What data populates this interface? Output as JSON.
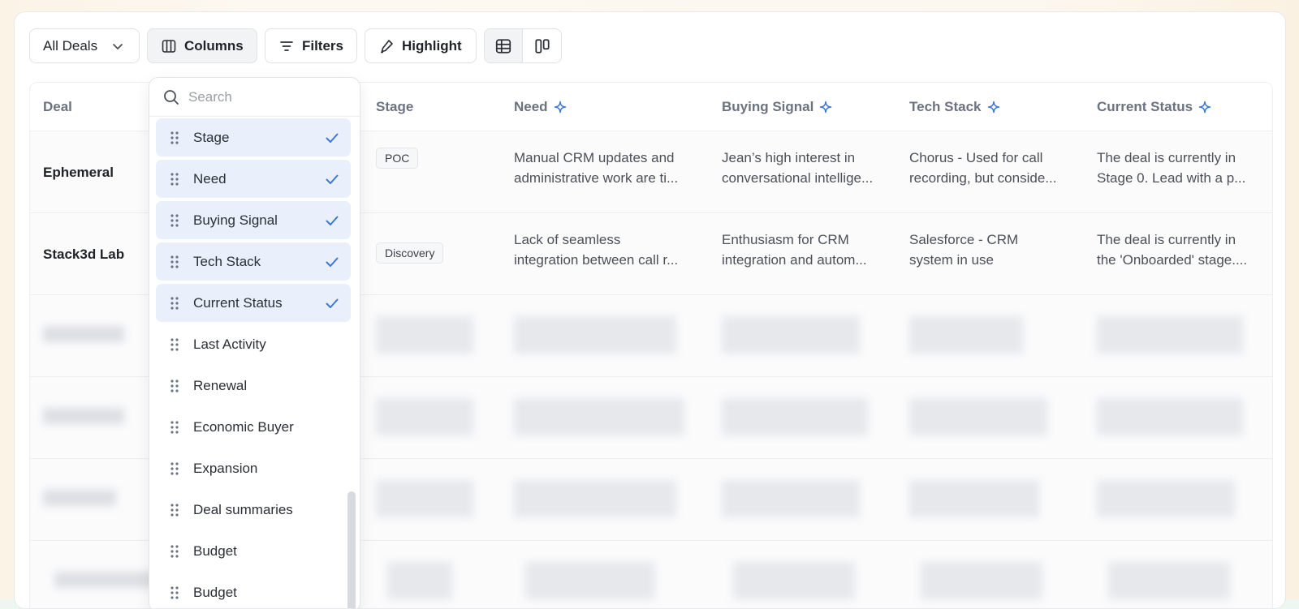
{
  "toolbar": {
    "view_select": "All Deals",
    "columns_label": "Columns",
    "filters_label": "Filters",
    "highlight_label": "Highlight"
  },
  "table": {
    "headers": {
      "deal": "Deal",
      "stage": "Stage",
      "need": "Need",
      "buying_signal": "Buying Signal",
      "tech_stack": "Tech Stack",
      "current_status": "Current Status"
    },
    "rows": [
      {
        "deal": "Ephemeral",
        "stage": "POC",
        "need": [
          "Manual CRM updates and",
          "administrative work are ti..."
        ],
        "buying_signal": [
          "Jean’s high interest in",
          "conversational intellige..."
        ],
        "tech_stack": [
          "Chorus - Used for call",
          "recording, but conside..."
        ],
        "current_status": [
          "The deal is currently in",
          "Stage 0. Lead with a p..."
        ]
      },
      {
        "deal": "Stack3d Lab",
        "stage": "Discovery",
        "need": [
          "Lack of seamless",
          "integration between call r..."
        ],
        "buying_signal": [
          "Enthusiasm for CRM",
          "integration and autom..."
        ],
        "tech_stack": [
          "Salesforce - CRM",
          "system in use"
        ],
        "current_status": [
          "The deal is currently in",
          "the 'Onboarded' stage...."
        ]
      }
    ]
  },
  "columns_menu": {
    "search_placeholder": "Search",
    "items": [
      {
        "label": "Stage",
        "checked": true
      },
      {
        "label": "Need",
        "checked": true
      },
      {
        "label": "Buying Signal",
        "checked": true
      },
      {
        "label": "Tech Stack",
        "checked": true
      },
      {
        "label": "Current Status",
        "checked": true
      },
      {
        "label": "Last Activity",
        "checked": false
      },
      {
        "label": "Renewal",
        "checked": false
      },
      {
        "label": "Economic Buyer",
        "checked": false
      },
      {
        "label": "Expansion",
        "checked": false
      },
      {
        "label": "Deal summaries",
        "checked": false
      },
      {
        "label": "Budget",
        "checked": false
      },
      {
        "label": "Budget",
        "checked": false
      }
    ]
  },
  "colors": {
    "accent": "#3b78d8",
    "selected_bg": "#e9f0fb"
  }
}
